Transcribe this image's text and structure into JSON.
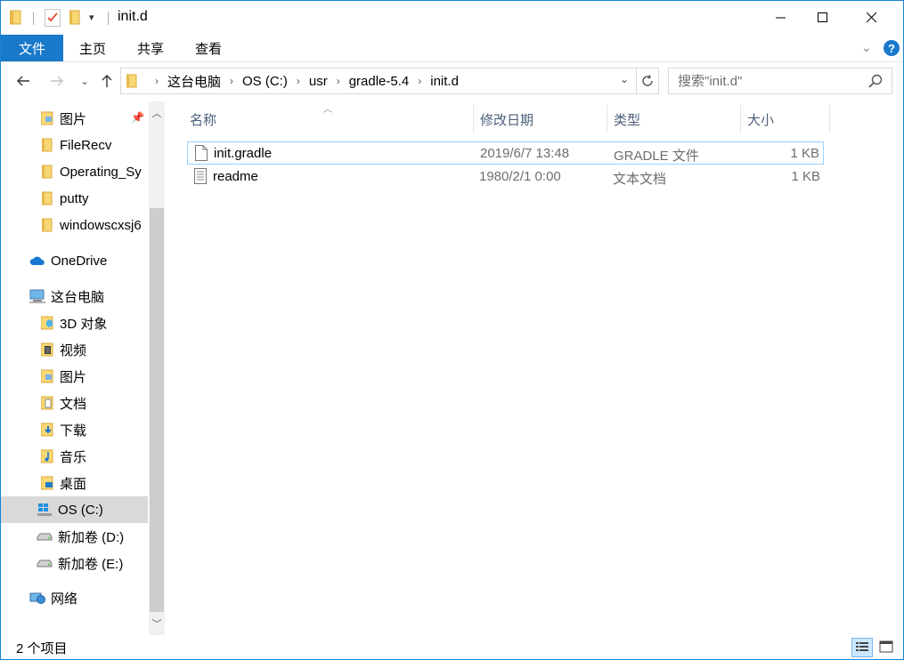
{
  "window": {
    "title": "init.d",
    "controls": {
      "minimize": "minimize",
      "maximize": "maximize",
      "close": "close"
    }
  },
  "ribbon": {
    "file_tab": "文件",
    "tabs": [
      "主页",
      "共享",
      "查看"
    ],
    "help": "?"
  },
  "navbar": {
    "breadcrumbs": [
      "这台电脑",
      "OS (C:)",
      "usr",
      "gradle-5.4",
      "init.d"
    ],
    "search_placeholder": "搜索\"init.d\""
  },
  "sidebar": {
    "items": [
      {
        "label": "图片",
        "icon": "pictures-folder-icon",
        "pinned": true
      },
      {
        "label": "FileRecv",
        "icon": "folder-icon"
      },
      {
        "label": "Operating_Sy",
        "icon": "folder-icon"
      },
      {
        "label": "putty",
        "icon": "folder-icon"
      },
      {
        "label": "windowscxsj6",
        "icon": "folder-icon"
      },
      {
        "label": "OneDrive",
        "icon": "onedrive-cloud-icon"
      },
      {
        "label": "这台电脑",
        "icon": "this-pc-icon"
      },
      {
        "label": "3D 对象",
        "icon": "3d-objects-folder-icon"
      },
      {
        "label": "视频",
        "icon": "videos-folder-icon"
      },
      {
        "label": "图片",
        "icon": "pictures-folder-icon"
      },
      {
        "label": "文档",
        "icon": "documents-folder-icon"
      },
      {
        "label": "下载",
        "icon": "downloads-folder-icon"
      },
      {
        "label": "音乐",
        "icon": "music-folder-icon"
      },
      {
        "label": "桌面",
        "icon": "desktop-folder-icon"
      },
      {
        "label": "OS (C:)",
        "icon": "windows-drive-icon",
        "selected": true
      },
      {
        "label": "新加卷 (D:)",
        "icon": "drive-icon"
      },
      {
        "label": "新加卷 (E:)",
        "icon": "drive-icon"
      },
      {
        "label": "网络",
        "icon": "network-icon"
      }
    ]
  },
  "content": {
    "columns": [
      "名称",
      "修改日期",
      "类型",
      "大小"
    ],
    "files": [
      {
        "name": "init.gradle",
        "modified": "2019/6/7 13:48",
        "type": "GRADLE 文件",
        "size": "1 KB",
        "icon": "blank-file-icon",
        "selected": true
      },
      {
        "name": "readme",
        "modified": "1980/2/1 0:00",
        "type": "文本文档",
        "size": "1 KB",
        "icon": "text-file-icon"
      }
    ]
  },
  "status": {
    "item_count": "2 个项目"
  },
  "colors": {
    "accent": "#1979ca",
    "folder": "#f8d775",
    "selection_border": "#99d1ff",
    "sidebar_selected": "#d9d9d9",
    "header_text": "#4c607a"
  }
}
